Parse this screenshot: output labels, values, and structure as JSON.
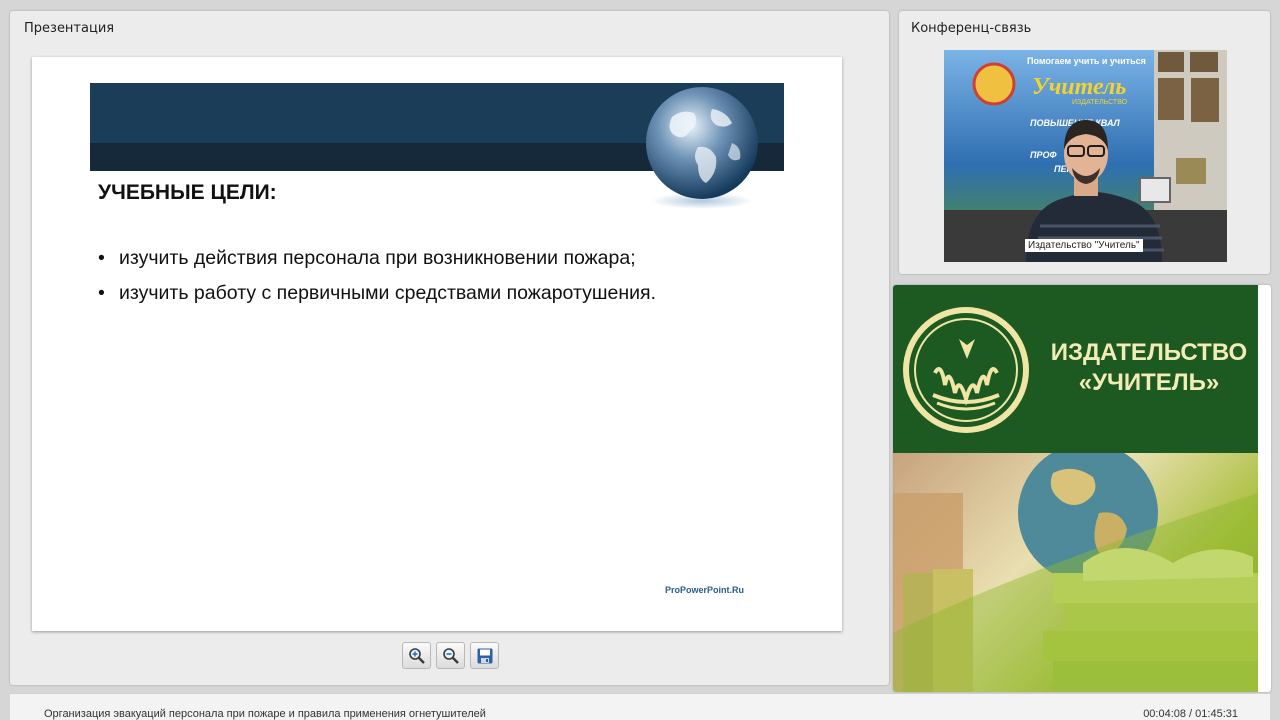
{
  "presentation": {
    "panel_title": "Презентация",
    "slide": {
      "heading": "УЧЕБНЫЕ ЦЕЛИ:",
      "bullets": [
        "изучить действия персонала при возникновении пожара;",
        "изучить работу с первичными средствами пожаротушения."
      ],
      "footer": "ProPowerPoint.Ru"
    },
    "toolbar": {
      "zoom_in_icon": "zoom-in-icon",
      "zoom_out_icon": "zoom-out-icon",
      "save_icon": "save-icon"
    }
  },
  "conference": {
    "panel_title": "Конференц-связь",
    "video_label": "Издательство \"Учитель\"",
    "banner_top": "Помогаем учить и учиться",
    "banner_brand": "Учитель",
    "banner_sub": "ИЗДАТЕЛЬСТВО",
    "banner_items": [
      "ПОВЫШЕНИЕ КВАЛ",
      "ПРОФ",
      "ПЕР"
    ]
  },
  "promo": {
    "line1": "ИЗДАТЕЛЬСТВО",
    "line2": "«УЧИТЕЛЬ»"
  },
  "status": {
    "title": "Организация эвакуаций персонала при пожаре и правила применения огнетушителей",
    "time": "00:04:08 / 01:45:31"
  }
}
